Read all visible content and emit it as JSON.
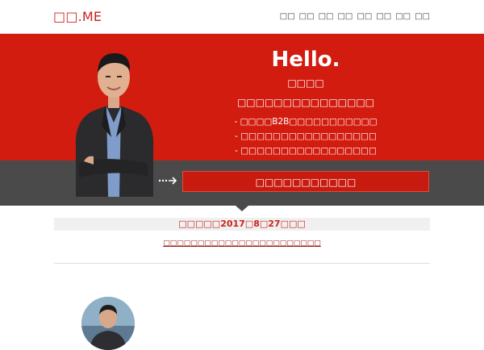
{
  "header": {
    "logo": "□□.ME",
    "nav": [
      "□□",
      "□□",
      "□□",
      "□□",
      "□□",
      "□□",
      "□□",
      "□□"
    ]
  },
  "hero": {
    "hello": "Hello.",
    "name": "□□□□",
    "tagline": "□□□□□□□□□□□□□□□",
    "bullets": [
      "- □□□□B2B□□□□□□□□□□□",
      "- □□□□□□□□□□□□□□□□□",
      "- □□□□□□□□□□□□□□□□□"
    ],
    "cta_label": "□□□□□□□□□□□",
    "colors": {
      "primary": "#d21c0f",
      "band": "#4a4a4a"
    }
  },
  "content": {
    "banner": "□□□□□2017□8□27□□□",
    "link": "□□□□□□□□□□□□□□□□□□□□□□□"
  },
  "icons": {
    "cta_arrow": "dotted-arrow-right-icon"
  }
}
